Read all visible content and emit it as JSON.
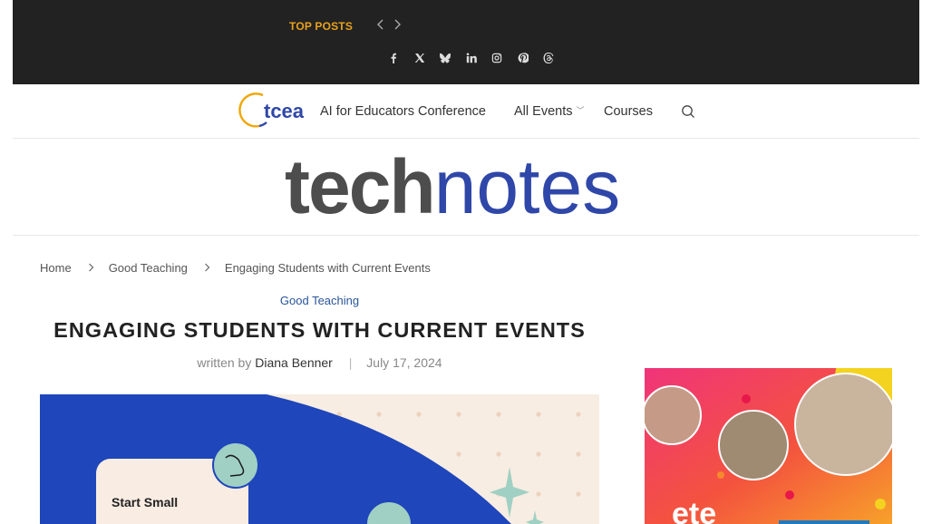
{
  "topbar": {
    "top_posts_label": "TOP POSTS",
    "prev_icon": "chevron-left-icon",
    "next_icon": "chevron-right-icon",
    "social": [
      "facebook-icon",
      "x-icon",
      "bluesky-icon",
      "linkedin-icon",
      "instagram-icon",
      "pinterest-icon",
      "threads-icon"
    ],
    "background_color": "#222222",
    "accent_color": "#e9a21b"
  },
  "nav": {
    "logo_text": "tcea",
    "items": [
      {
        "label": "AI for Educators Conference"
      },
      {
        "label": "All Events",
        "has_dropdown": true
      },
      {
        "label": "Courses"
      }
    ],
    "search_icon": "search-icon"
  },
  "masthead": {
    "brand_part1": "tech",
    "brand_part2": "notes"
  },
  "breadcrumb": {
    "items": [
      "Home",
      "Good Teaching",
      "Engaging Students with Current Events"
    ],
    "separator": "›"
  },
  "article": {
    "category": "Good Teaching",
    "title": "ENGAGING STUDENTS WITH CURRENT EVENTS",
    "byline_prefix": "written by",
    "author": "Diana Benner",
    "date": "July 17, 2024",
    "featured_image": {
      "card_text": "Start Small"
    }
  },
  "sidebar": {
    "ad_logo_text": "ete"
  }
}
